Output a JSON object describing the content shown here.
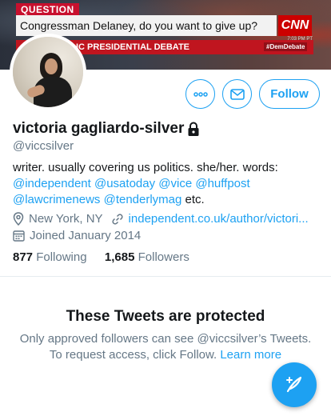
{
  "banner": {
    "question_label": "QUESTION",
    "question_text": "Congressman Delaney, do you want to give up?",
    "network": "CNN",
    "time_tag": "7:03 PM PT",
    "debate_title": "IC PRESIDENTIAL DEBATE",
    "hashtag": "#DemDebate"
  },
  "actions": {
    "more_icon": "more-dots-icon",
    "message_icon": "envelope-icon",
    "follow_label": "Follow"
  },
  "profile": {
    "display_name": "victoria gagliardo-silver",
    "handle": "@viccsilver",
    "bio_text": "writer. usually covering us politics. she/her. words:",
    "bio_mentions": [
      "@independent",
      "@usatoday",
      "@vice",
      "@huffpost",
      "@lawcrimenews",
      "@tenderlymag"
    ],
    "bio_suffix": "etc.",
    "location": "New York, NY",
    "website": "independent.co.uk/author/victori...",
    "joined": "Joined January 2014"
  },
  "stats": {
    "following_count": "877",
    "following_label": "Following",
    "followers_count": "1,685",
    "followers_label": "Followers"
  },
  "protected": {
    "title": "These Tweets are protected",
    "message": "Only approved followers can see @viccsilver’s Tweets. To request access, click Follow.",
    "learn_more": "Learn more"
  },
  "colors": {
    "accent": "#1da1f2",
    "text": "#14171a",
    "secondary": "#657786"
  }
}
